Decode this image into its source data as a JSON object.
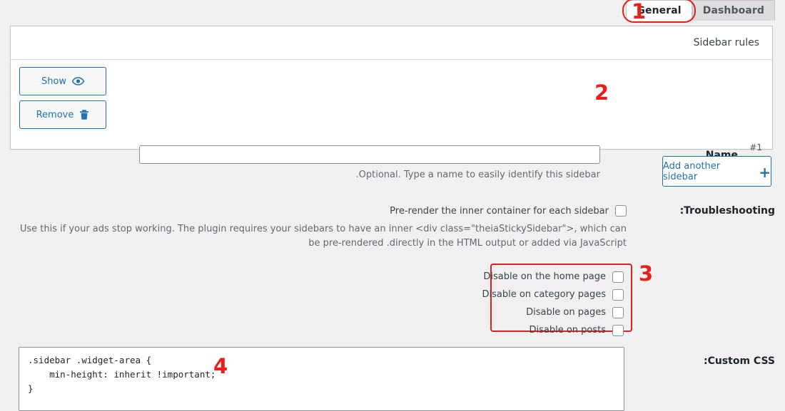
{
  "tabs": [
    {
      "label": "General",
      "state": "active"
    },
    {
      "label": "Dashboard",
      "state": "inactive"
    }
  ],
  "panel": {
    "header_title": "Sidebar rules",
    "buttons": {
      "show": {
        "label": "Show",
        "icon": "eye-icon"
      },
      "remove": {
        "label": "Remove",
        "icon": "trash-icon"
      }
    },
    "name_field": {
      "label": "Name",
      "index": "#1",
      "value": "",
      "placeholder": "",
      "help": ".Optional. Type a name to easily identify this sidebar"
    }
  },
  "add_sidebar": {
    "label": "Add another sidebar",
    "icon": "plus-icon"
  },
  "troubleshooting": {
    "label": ":Troubleshooting",
    "prerender": {
      "label": "Pre-render the inner container for each sidebar",
      "checked": false
    },
    "description": "Use this if your ads stop working. The plugin requires your sidebars to have an inner <div class=\"theiaStickySidebar\">, which can be pre-rendered .directly in the HTML output or added via JavaScript"
  },
  "disable_options": [
    {
      "label": "Disable on the home page",
      "checked": false
    },
    {
      "label": "Disable on category pages",
      "checked": false
    },
    {
      "label": "Disable on pages",
      "checked": false
    },
    {
      "label": "Disable on posts",
      "checked": false
    }
  ],
  "custom_css": {
    "label": ":Custom CSS",
    "code": ".sidebar .widget-area {\n    min-height: inherit !important;\n}"
  },
  "annotations": [
    {
      "number": "1"
    },
    {
      "number": "2"
    },
    {
      "number": "3"
    },
    {
      "number": "4"
    }
  ],
  "colors": {
    "accent_blue": "#2271b1",
    "annotation_red": "#e8201a",
    "page_bg": "#f0f0f1",
    "panel_bg": "#ffffff",
    "border_gray": "#c3c4c7"
  }
}
